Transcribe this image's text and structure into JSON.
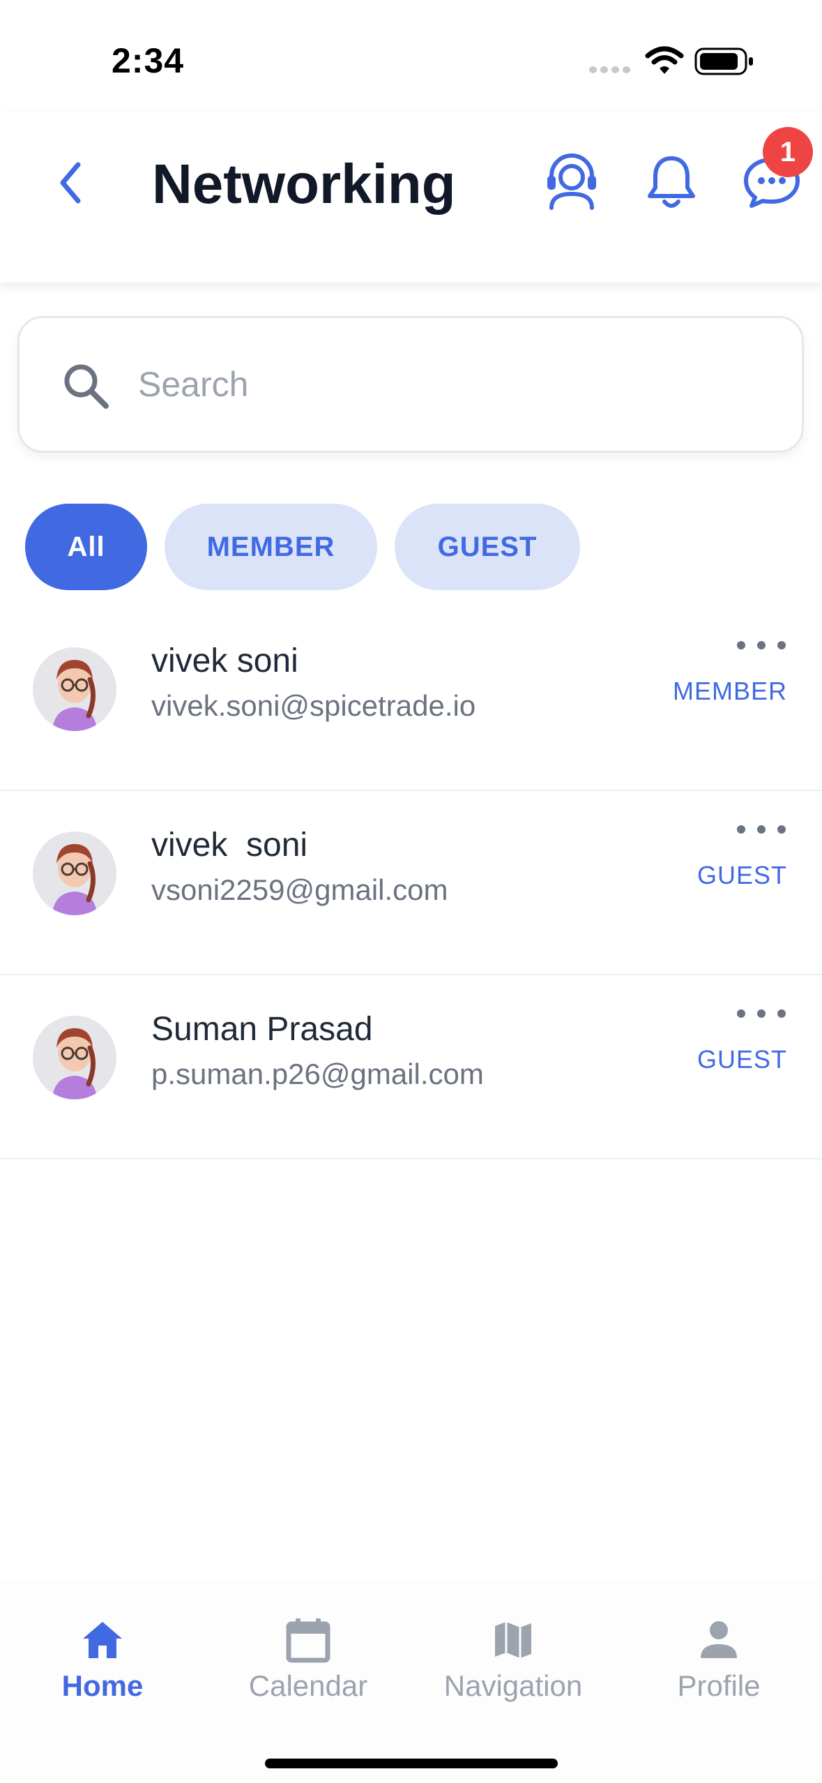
{
  "status_bar": {
    "time": "2:34"
  },
  "header": {
    "title": "Networking",
    "chat_badge_count": "1",
    "icons": [
      "back-chevron-icon",
      "support-headset-icon",
      "bell-icon",
      "chat-bubble-icon"
    ]
  },
  "search": {
    "placeholder": "Search",
    "value": ""
  },
  "filters": [
    {
      "label": "All",
      "selected": true
    },
    {
      "label": "MEMBER",
      "selected": false
    },
    {
      "label": "GUEST",
      "selected": false
    }
  ],
  "contacts": [
    {
      "name": "vivek soni",
      "email": "vivek.soni@spicetrade.io",
      "role": "MEMBER"
    },
    {
      "name": "vivek  soni",
      "email": "vsoni2259@gmail.com",
      "role": "GUEST"
    },
    {
      "name": "Suman Prasad",
      "email": "p.suman.p26@gmail.com",
      "role": "GUEST"
    }
  ],
  "bottom_nav": [
    {
      "label": "Home",
      "icon": "home-icon",
      "active": true
    },
    {
      "label": "Calendar",
      "icon": "calendar-icon",
      "active": false
    },
    {
      "label": "Navigation",
      "icon": "map-icon",
      "active": false
    },
    {
      "label": "Profile",
      "icon": "person-icon",
      "active": false
    }
  ],
  "colors": {
    "accent": "#4169e1",
    "chip_inactive_bg": "#dbe3f8",
    "badge": "#ef4444",
    "muted_text": "#9ca3af"
  }
}
